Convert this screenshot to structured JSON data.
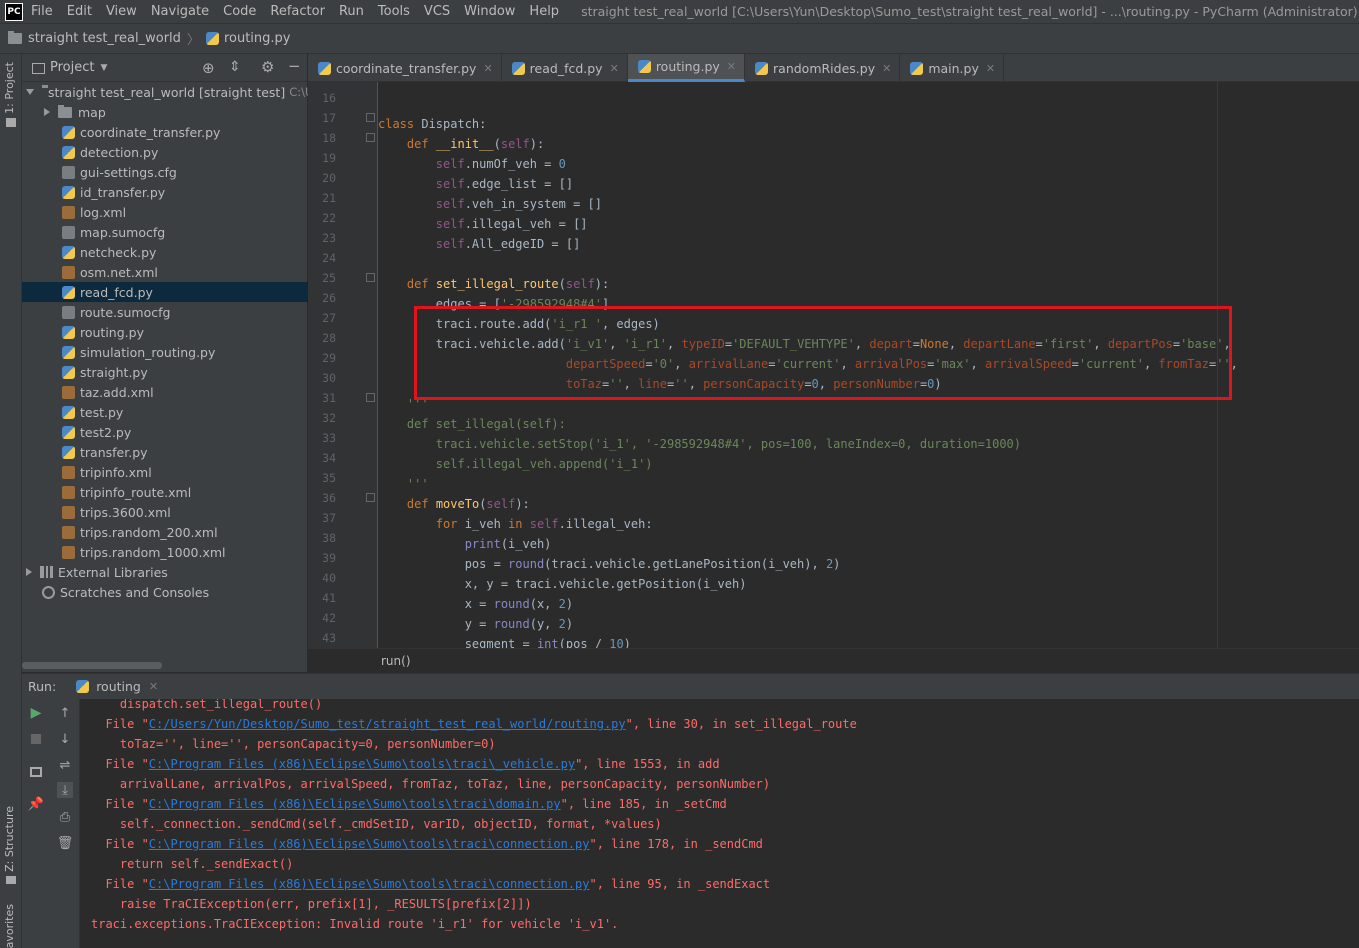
{
  "menubar": {
    "logo": "PC",
    "items": [
      "File",
      "Edit",
      "View",
      "Navigate",
      "Code",
      "Refactor",
      "Run",
      "Tools",
      "VCS",
      "Window",
      "Help"
    ],
    "title": "straight test_real_world [C:\\Users\\Yun\\Desktop\\Sumo_test\\straight test_real_world] - ...\\routing.py - PyCharm (Administrator)"
  },
  "navbar": {
    "project": "straight test_real_world",
    "file": "routing.py"
  },
  "leftstrip": {
    "project_tab": "1: Project",
    "structure_tab": "Z: Structure",
    "favorites_tab": "avorites"
  },
  "project": {
    "header": "Project",
    "root": "straight test_real_world",
    "root_suffix": "[straight test]",
    "root_path": "C:\\Us",
    "items": [
      {
        "label": "map",
        "type": "folder"
      },
      {
        "label": "coordinate_transfer.py",
        "type": "py"
      },
      {
        "label": "detection.py",
        "type": "py"
      },
      {
        "label": "gui-settings.cfg",
        "type": "cfg"
      },
      {
        "label": "id_transfer.py",
        "type": "py"
      },
      {
        "label": "log.xml",
        "type": "xml"
      },
      {
        "label": "map.sumocfg",
        "type": "cfg"
      },
      {
        "label": "netcheck.py",
        "type": "py"
      },
      {
        "label": "osm.net.xml",
        "type": "xml"
      },
      {
        "label": "read_fcd.py",
        "type": "py",
        "selected": true
      },
      {
        "label": "route.sumocfg",
        "type": "cfg"
      },
      {
        "label": "routing.py",
        "type": "py"
      },
      {
        "label": "simulation_routing.py",
        "type": "py"
      },
      {
        "label": "straight.py",
        "type": "py"
      },
      {
        "label": "taz.add.xml",
        "type": "xml"
      },
      {
        "label": "test.py",
        "type": "py"
      },
      {
        "label": "test2.py",
        "type": "py"
      },
      {
        "label": "transfer.py",
        "type": "py"
      },
      {
        "label": "tripinfo.xml",
        "type": "xml"
      },
      {
        "label": "tripinfo_route.xml",
        "type": "xml"
      },
      {
        "label": "trips.3600.xml",
        "type": "xml"
      },
      {
        "label": "trips.random_200.xml",
        "type": "xml"
      },
      {
        "label": "trips.random_1000.xml",
        "type": "xml"
      }
    ],
    "external": "External Libraries",
    "scratches": "Scratches and Consoles"
  },
  "tabs": [
    {
      "label": "coordinate_transfer.py",
      "active": false
    },
    {
      "label": "read_fcd.py",
      "active": false
    },
    {
      "label": "routing.py",
      "active": true
    },
    {
      "label": "randomRides.py",
      "active": false
    },
    {
      "label": "main.py",
      "active": false
    }
  ],
  "editor": {
    "line_numbers": [
      "16",
      "17",
      "18",
      "19",
      "20",
      "21",
      "22",
      "23",
      "24",
      "25",
      "26",
      "27",
      "28",
      "29",
      "30",
      "31",
      "32",
      "33",
      "34",
      "35",
      "36",
      "37",
      "38",
      "39",
      "40",
      "41",
      "42",
      "43"
    ],
    "breadcrumb": "run()"
  },
  "run": {
    "label": "Run:",
    "tab": "routing",
    "output": [
      "    dispatch.set_illegal_route()",
      "  File \"",
      "C:/Users/Yun/Desktop/Sumo_test/straight_test_real_world/routing.py",
      "\", line 30, in set_illegal_route",
      "    toTaz='', line='', personCapacity=0, personNumber=0)",
      "C:\\Program Files (x86)\\Eclipse\\Sumo\\tools\\traci\\_vehicle.py",
      "\", line 1553, in add",
      "    arrivalLane, arrivalPos, arrivalSpeed, fromTaz, toTaz, line, personCapacity, personNumber)",
      "C:\\Program Files (x86)\\Eclipse\\Sumo\\tools\\traci\\domain.py",
      "\", line 185, in _setCmd",
      "    self._connection._sendCmd(self._cmdSetID, varID, objectID, format, *values)",
      "C:\\Program Files (x86)\\Eclipse\\Sumo\\tools\\traci\\connection.py",
      "\", line 178, in _sendCmd",
      "    return self._sendExact()",
      "\", line 95, in _sendExact",
      "    raise TraCIException(err, prefix[1], _RESULTS[prefix[2]])",
      "traci.exceptions.TraCIException: Invalid route 'i_r1' for vehicle 'i_v1'."
    ]
  }
}
